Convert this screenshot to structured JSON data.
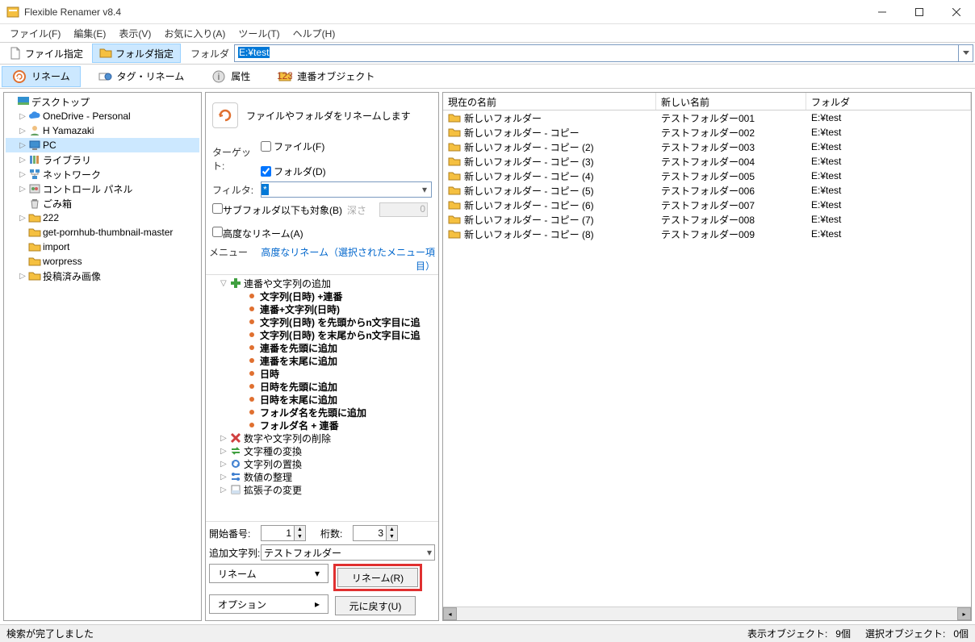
{
  "app": {
    "title": "Flexible Renamer v8.4"
  },
  "menu": {
    "file": "ファイル(F)",
    "edit": "編集(E)",
    "view": "表示(V)",
    "favorites": "お気に入り(A)",
    "tools": "ツール(T)",
    "help": "ヘルプ(H)"
  },
  "toolbar1": {
    "file_spec": "ファイル指定",
    "folder_spec": "フォルダ指定",
    "folder_label": "フォルダ",
    "path": "E:¥test"
  },
  "toolbar2": {
    "rename": "リネーム",
    "tag_rename": "タグ・リネーム",
    "attributes": "属性",
    "serial_object": "連番オブジェクト"
  },
  "tree": {
    "root": "デスクトップ",
    "items": [
      {
        "label": "OneDrive - Personal",
        "icon": "cloud"
      },
      {
        "label": "H Yamazaki",
        "icon": "user"
      },
      {
        "label": "PC",
        "icon": "pc",
        "selected": true
      },
      {
        "label": "ライブラリ",
        "icon": "library"
      },
      {
        "label": "ネットワーク",
        "icon": "network"
      },
      {
        "label": "コントロール パネル",
        "icon": "control"
      },
      {
        "label": "ごみ箱",
        "icon": "recycle",
        "noexpand": true
      },
      {
        "label": "222",
        "icon": "folder"
      },
      {
        "label": "get-pornhub-thumbnail-master",
        "icon": "folder",
        "noexpand": true
      },
      {
        "label": "import",
        "icon": "folder",
        "noexpand": true
      },
      {
        "label": "worpress",
        "icon": "folder",
        "noexpand": true
      },
      {
        "label": "投稿済み画像",
        "icon": "folder"
      }
    ]
  },
  "mid": {
    "title": "ファイルやフォルダをリネームします",
    "target_label": "ターゲット:",
    "target_file": "ファイル(F)",
    "target_folder": "フォルダ(D)",
    "filter_label": "フィルタ:",
    "filter_value": "*",
    "subfolder": "サブフォルダ以下も対象(B)",
    "depth_label": "深さ",
    "depth_value": "0",
    "advanced": "高度なリネーム(A)",
    "menu_label": "メニュー",
    "menu_detail": "高度なリネーム（選択されたメニュー項目）",
    "optree": {
      "groups": [
        {
          "label": "連番や文字列の追加",
          "icon": "plus",
          "expanded": true,
          "children": [
            "文字列(日時) +連番",
            "連番+文字列(日時)",
            "文字列(日時) を先頭からn文字目に追",
            "文字列(日時) を末尾からn文字目に追",
            "連番を先頭に追加",
            "連番を末尾に追加",
            "日時",
            "日時を先頭に追加",
            "日時を末尾に追加",
            "フォルダ名を先頭に追加",
            "フォルダ名 + 連番"
          ]
        },
        {
          "label": "数字や文字列の削除",
          "icon": "delete"
        },
        {
          "label": "文字種の変換",
          "icon": "convert"
        },
        {
          "label": "文字列の置換",
          "icon": "replace"
        },
        {
          "label": "数値の整理",
          "icon": "number"
        },
        {
          "label": "拡張子の変更",
          "icon": "ext"
        }
      ]
    },
    "start_num_label": "開始番号:",
    "start_num": "1",
    "digits_label": "桁数:",
    "digits": "3",
    "add_string_label": "追加文字列:",
    "add_string": "テストフォルダー",
    "rename_combo": "リネーム",
    "rename_btn": "リネーム(R)",
    "option_btn": "オプション",
    "undo_btn": "元に戻す(U)"
  },
  "filelist": {
    "headers": {
      "current": "現在の名前",
      "new": "新しい名前",
      "folder": "フォルダ"
    },
    "rows": [
      {
        "current": "新しいフォルダー",
        "new": "テストフォルダー001",
        "folder": "E:¥test"
      },
      {
        "current": "新しいフォルダー - コピー",
        "new": "テストフォルダー002",
        "folder": "E:¥test"
      },
      {
        "current": "新しいフォルダー - コピー (2)",
        "new": "テストフォルダー003",
        "folder": "E:¥test"
      },
      {
        "current": "新しいフォルダー - コピー (3)",
        "new": "テストフォルダー004",
        "folder": "E:¥test"
      },
      {
        "current": "新しいフォルダー - コピー (4)",
        "new": "テストフォルダー005",
        "folder": "E:¥test"
      },
      {
        "current": "新しいフォルダー - コピー (5)",
        "new": "テストフォルダー006",
        "folder": "E:¥test"
      },
      {
        "current": "新しいフォルダー - コピー (6)",
        "new": "テストフォルダー007",
        "folder": "E:¥test"
      },
      {
        "current": "新しいフォルダー - コピー (7)",
        "new": "テストフォルダー008",
        "folder": "E:¥test"
      },
      {
        "current": "新しいフォルダー - コピー (8)",
        "new": "テストフォルダー009",
        "folder": "E:¥test"
      }
    ]
  },
  "status": {
    "message": "検索が完了しました",
    "display_label": "表示オブジェクト:",
    "display_count": "9個",
    "select_label": "選択オブジェクト:",
    "select_count": "0個"
  }
}
